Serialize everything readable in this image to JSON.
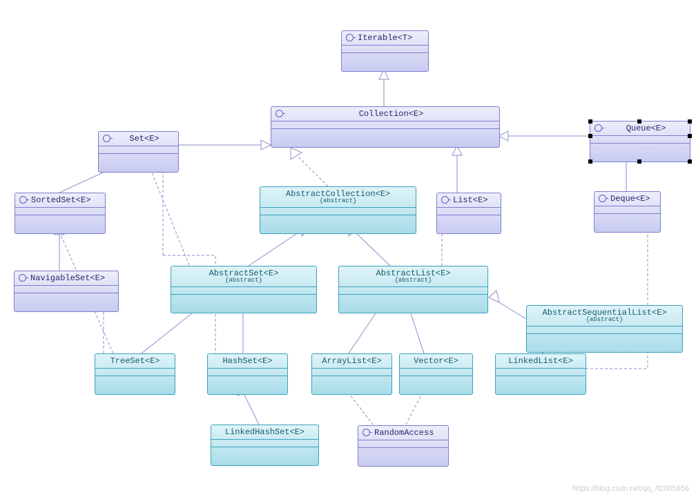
{
  "watermark": "https://blog.csdn.net/qq_/t2085656",
  "nodes": {
    "iterable": {
      "label": "Iterable<T>"
    },
    "collection": {
      "label": "Collection<E>"
    },
    "set": {
      "label": "Set<E>"
    },
    "queue": {
      "label": "Queue<E>"
    },
    "sortedset": {
      "label": "SortedSet<E>"
    },
    "navigableset": {
      "label": "NavigableSet<E>"
    },
    "abstractcollection": {
      "label": "AbstractCollection<E>",
      "stereo": "{abstract}"
    },
    "list": {
      "label": "List<E>"
    },
    "deque": {
      "label": "Deque<E>"
    },
    "abstractset": {
      "label": "AbstractSet<E>",
      "stereo": "{abstract}"
    },
    "abstractlist": {
      "label": "AbstractList<E>",
      "stereo": "{abstract}"
    },
    "abstractseqlist": {
      "label": "AbstractSequentialList<E>",
      "stereo": "{abstract}"
    },
    "treeset": {
      "label": "TreeSet<E>"
    },
    "hashset": {
      "label": "HashSet<E>"
    },
    "arraylist": {
      "label": "ArrayList<E>"
    },
    "vector": {
      "label": "Vector<E>"
    },
    "linkedlist": {
      "label": "LinkedList<E>"
    },
    "linkedhashset": {
      "label": "LinkedHashSet<E>"
    },
    "randomaccess": {
      "label": "RandomAccess"
    }
  }
}
